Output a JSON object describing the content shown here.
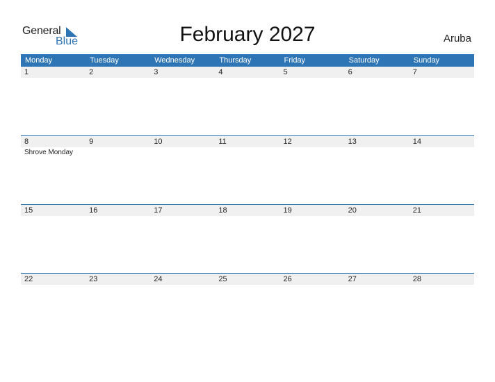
{
  "logo": {
    "word1": "General",
    "word2": "Blue"
  },
  "title": "February 2027",
  "country": "Aruba",
  "colors": {
    "accent": "#2e75b6",
    "day_strip": "#f0f0f0"
  },
  "weekdays": [
    "Monday",
    "Tuesday",
    "Wednesday",
    "Thursday",
    "Friday",
    "Saturday",
    "Sunday"
  ],
  "weeks": [
    {
      "days": [
        "1",
        "2",
        "3",
        "4",
        "5",
        "6",
        "7"
      ],
      "events": [
        "",
        "",
        "",
        "",
        "",
        "",
        ""
      ]
    },
    {
      "days": [
        "8",
        "9",
        "10",
        "11",
        "12",
        "13",
        "14"
      ],
      "events": [
        "Shrove Monday",
        "",
        "",
        "",
        "",
        "",
        ""
      ]
    },
    {
      "days": [
        "15",
        "16",
        "17",
        "18",
        "19",
        "20",
        "21"
      ],
      "events": [
        "",
        "",
        "",
        "",
        "",
        "",
        ""
      ]
    },
    {
      "days": [
        "22",
        "23",
        "24",
        "25",
        "26",
        "27",
        "28"
      ],
      "events": [
        "",
        "",
        "",
        "",
        "",
        "",
        ""
      ]
    }
  ]
}
